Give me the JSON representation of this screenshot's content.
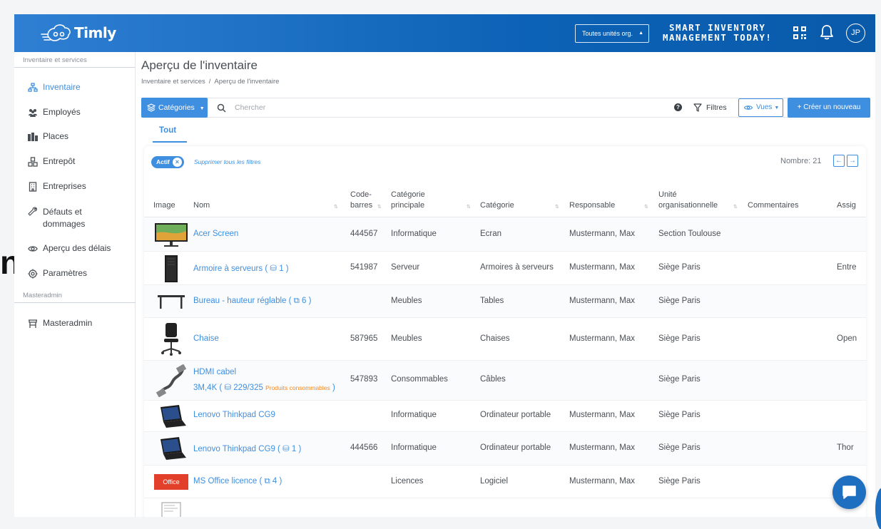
{
  "app": {
    "brand": "Timly",
    "org_select": "Toutes unités org.",
    "slogan_line1": "SMART INVENTORY",
    "slogan_line2": "MANAGEMENT TODAY!",
    "avatar_initials": "JP"
  },
  "sidebar": {
    "section1": "Inventaire et services",
    "items": [
      {
        "label": "Inventaire",
        "icon": "sitemap-icon",
        "active": true
      },
      {
        "label": "Employés",
        "icon": "users-icon"
      },
      {
        "label": "Places",
        "icon": "buildings-icon"
      },
      {
        "label": "Entrepôt",
        "icon": "boxes-icon"
      },
      {
        "label": "Entreprises",
        "icon": "building-icon"
      },
      {
        "label": "Défauts et dommages",
        "icon": "wrench-icon"
      },
      {
        "label": "Aperçu des délais",
        "icon": "eye-icon"
      },
      {
        "label": "Paramètres",
        "icon": "gear-icon"
      }
    ],
    "section2": "Masteradmin",
    "admin_item": {
      "label": "Masteradmin",
      "icon": "store-icon"
    }
  },
  "page": {
    "title": "Aperçu de l'inventaire",
    "breadcrumb": [
      "Inventaire et services",
      "Aperçu de l'inventaire"
    ]
  },
  "toolbar": {
    "categories": "Catégories",
    "search_placeholder": "Chercher",
    "help": "?",
    "filters": "Filtres",
    "views": "Vues",
    "create": "+ Créer un nouveau"
  },
  "tabs": {
    "all": "Tout"
  },
  "filters_bar": {
    "chip": "Actif",
    "chip_close": "×",
    "clear": "Supprimer tous les filtres",
    "count": "Nombre: 21",
    "prev": "←",
    "next": "→"
  },
  "table": {
    "headers": {
      "image": "Image",
      "name": "Nom",
      "barcode1": "Code-",
      "barcode2": "barres",
      "maincat1": "Catégorie",
      "maincat2": "principale",
      "category": "Catégorie",
      "owner": "Responsable",
      "orgunit1": "Unité",
      "orgunit2": "organisationnelle",
      "comments": "Commentaires",
      "assigned": "Assig"
    },
    "rows": [
      {
        "name": "Acer Screen",
        "barcode": "444567",
        "maincat": "Informatique",
        "category": "Ecran",
        "owner": "Mustermann, Max",
        "org": "Section Toulouse",
        "assigned": "",
        "thumb": "monitor"
      },
      {
        "name": "Armoire à serveurs ( ⛁ 1 )",
        "barcode": "541987",
        "maincat": "Serveur",
        "category": "Armoires à serveurs",
        "owner": "Mustermann, Max",
        "org": "Siège Paris",
        "assigned": "Entre",
        "thumb": "server"
      },
      {
        "name": "Bureau - hauteur réglable ( ⧉ 6 )",
        "barcode": "",
        "maincat": "Meubles",
        "category": "Tables",
        "owner": "Mustermann, Max",
        "org": "Siège Paris",
        "assigned": "",
        "thumb": "desk"
      },
      {
        "name": "Chaise",
        "barcode": "587965",
        "maincat": "Meubles",
        "category": "Chaises",
        "owner": "Mustermann, Max",
        "org": "Siège Paris",
        "assigned": "Open",
        "thumb": "chair"
      },
      {
        "name": "HDMI cabel",
        "name2": "3M,4K ( ⛁ 229/325 ",
        "cons": "Produits consommables",
        "name2_end": " )",
        "barcode": "547893",
        "maincat": "Consommables",
        "category": "Câbles",
        "owner": "",
        "org": "Siège Paris",
        "assigned": "",
        "thumb": "cable"
      },
      {
        "name": "Lenovo Thinkpad CG9",
        "barcode": "",
        "maincat": "Informatique",
        "category": "Ordinateur portable",
        "owner": "Mustermann, Max",
        "org": "Siège Paris",
        "assigned": "",
        "thumb": "laptop"
      },
      {
        "name": "Lenovo Thinkpad CG9 ( ⛁ 1 )",
        "barcode": "444566",
        "maincat": "Informatique",
        "category": "Ordinateur portable",
        "owner": "Mustermann, Max",
        "org": "Siège Paris",
        "assigned": "Thor",
        "thumb": "laptop"
      },
      {
        "name": "MS Office licence ( ⧉ 4 )",
        "barcode": "",
        "maincat": "Licences",
        "category": "Logiciel",
        "owner": "Mustermann, Max",
        "org": "Siège Paris",
        "assigned": "",
        "thumb": "office",
        "thumb_label": "Office"
      }
    ]
  },
  "colors": {
    "brand_blue": "#3f8fe0",
    "header_blue": "#0c62b6",
    "consumable_orange": "#f08a24",
    "office_red": "#e2402a"
  },
  "edge_glyph": "n"
}
